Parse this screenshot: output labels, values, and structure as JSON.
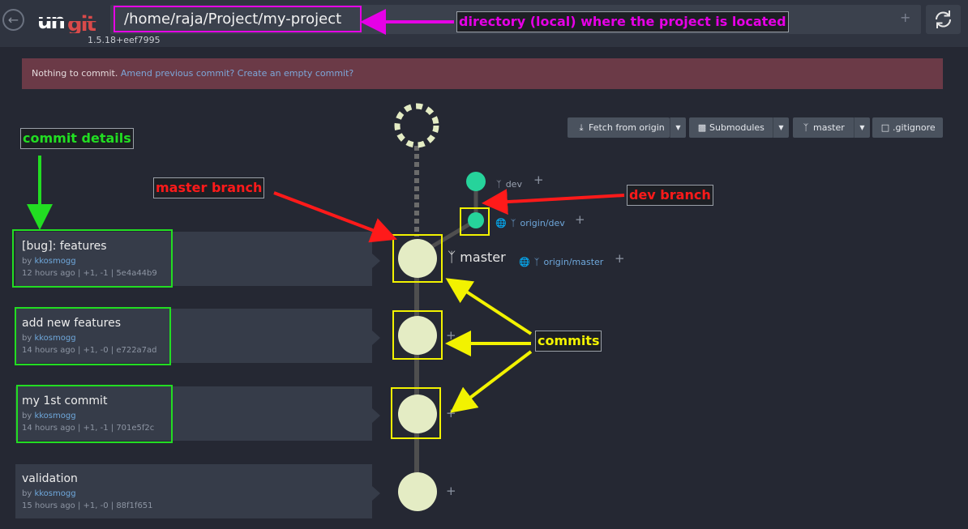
{
  "header": {
    "logo_text": "ungit",
    "version": "1.5.18+eef7995",
    "path": "/home/raja/Project/my-project",
    "path_add": "+",
    "back_icon": "back-arrow-icon",
    "refresh_icon": "refresh-icon"
  },
  "banner": {
    "text": "Nothing to commit.",
    "amend_link": "Amend previous commit?",
    "empty_link": "Create an empty commit?"
  },
  "toolbar": {
    "fetch_label": "Fetch from origin",
    "submodules_label": "Submodules",
    "branch_label": "master",
    "gitignore_label": ".gitignore"
  },
  "graph": {
    "refs": {
      "dev": "dev",
      "origin_dev": "origin/dev",
      "master": "master",
      "origin_master": "origin/master",
      "add": "+"
    },
    "colors": {
      "node": "#e4ecc4",
      "branch_node": "#26d39b",
      "line": "#4f4f4f"
    }
  },
  "commits": [
    {
      "title": "[bug]: features",
      "by": "by",
      "author": "kkosmogg",
      "meta": "12 hours ago | +1, -1 | 5e4a44b9"
    },
    {
      "title": "add new features",
      "by": "by",
      "author": "kkosmogg",
      "meta": "14 hours ago | +1, -0 | e722a7ad"
    },
    {
      "title": "my 1st commit",
      "by": "by",
      "author": "kkosmogg",
      "meta": "14 hours ago | +1, -1 | 701e5f2c"
    },
    {
      "title": "validation",
      "by": "by",
      "author": "kkosmogg",
      "meta": "15 hours ago | +1, -0 | 88f1f651"
    }
  ],
  "annotations": {
    "directory": "directory (local) where the project is located",
    "commit_details": "commit details",
    "master_branch": "master branch",
    "dev_branch": "dev branch",
    "commits": "commits",
    "colors": {
      "magenta": "#e600e6",
      "red": "#ff1a1a",
      "green": "#22dd22",
      "yellow": "#f2f200"
    }
  }
}
